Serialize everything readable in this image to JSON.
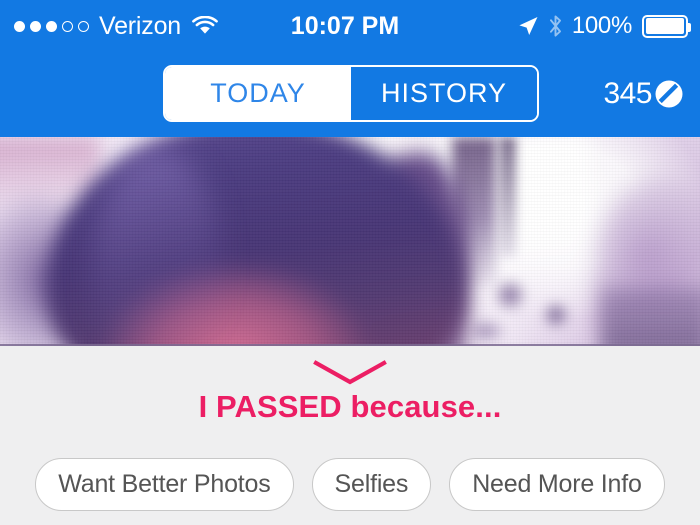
{
  "status_bar": {
    "signal": {
      "total_dots": 5,
      "filled_dots": 3,
      "icon": "signal-dots-icon"
    },
    "carrier": "Verizon",
    "wifi_icon": "wifi-icon",
    "time": "10:07 PM",
    "location_icon": "location-arrow-icon",
    "bluetooth_icon": "bluetooth-icon",
    "battery_percent": "100%",
    "battery_icon": "battery-full-icon",
    "background_color": "#1279e3",
    "foreground_color": "#ffffff"
  },
  "nav_bar": {
    "segmented_control": {
      "options": [
        {
          "label": "TODAY",
          "selected": false,
          "style": "light"
        },
        {
          "label": "HISTORY",
          "selected": true,
          "style": "dark"
        }
      ]
    },
    "counter": {
      "value": "345",
      "icon": "pass-slash-circle-icon"
    },
    "background_color": "#1279e3"
  },
  "photo": {
    "alt": "blurry close-up photo of a person with dark purple hair against a bright overexposed street background",
    "dominant_colors": [
      "#4b3c80",
      "#8d4a73",
      "#ffffff",
      "#c8a8d2"
    ]
  },
  "content": {
    "chevron_icon": "chevron-down-icon",
    "prompt": "I PASSED because...",
    "prompt_color": "#ec1e64",
    "background_color": "#efeff0",
    "reasons": [
      {
        "label": "Want Better Photos"
      },
      {
        "label": "Selfies"
      },
      {
        "label": "Need More Info"
      }
    ]
  }
}
